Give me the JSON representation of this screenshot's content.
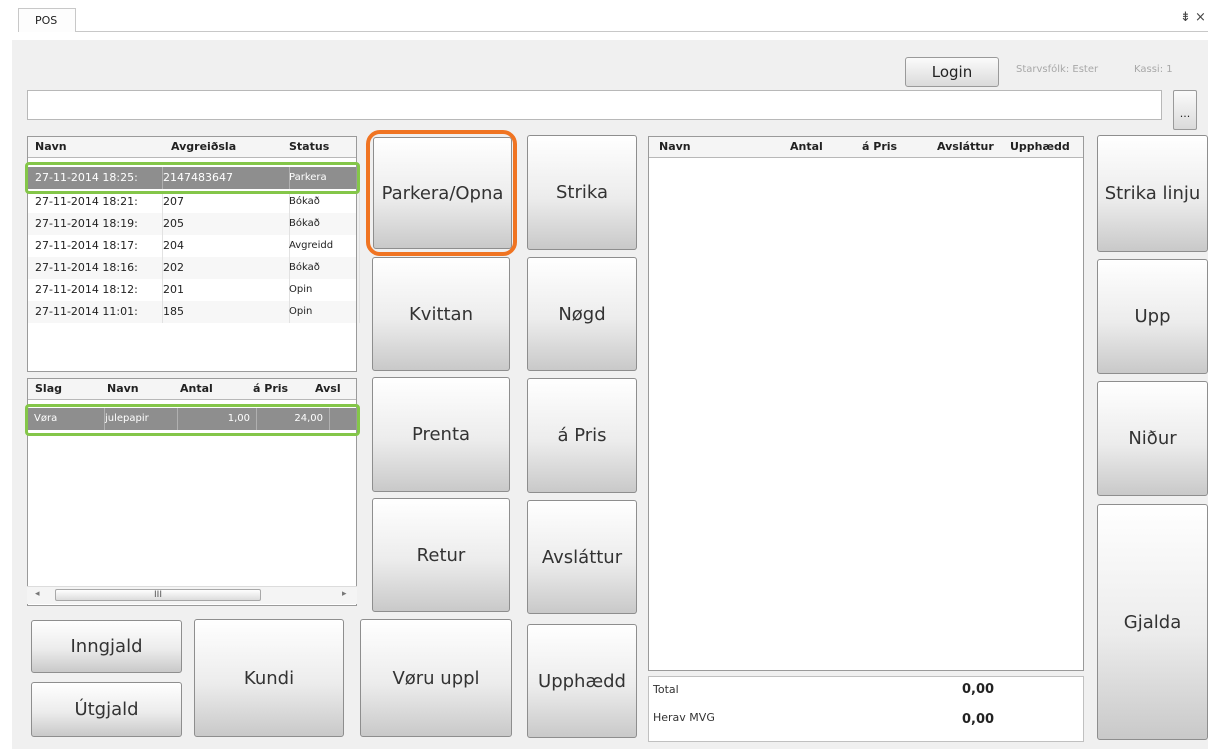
{
  "window": {
    "tab_title": "POS",
    "pin": "⇟ ×"
  },
  "header": {
    "login_label": "Login",
    "staff_label": "Starvsfólk: Ester",
    "register_label": "Kassi: 1",
    "search_value": "",
    "more_label": "..."
  },
  "orders": {
    "columns": [
      "Navn",
      "Avgreiðsla",
      "Status"
    ],
    "rows": [
      [
        "27-11-2014 18:25:",
        "2147483647",
        "Parkera"
      ],
      [
        "27-11-2014 18:21:",
        "207",
        "Bókað"
      ],
      [
        "27-11-2014 18:19:",
        "205",
        "Bókað"
      ],
      [
        "27-11-2014 18:17:",
        "204",
        "Avgreidd"
      ],
      [
        "27-11-2014 18:16:",
        "202",
        "Bókað"
      ],
      [
        "27-11-2014 18:12:",
        "201",
        "Opin"
      ],
      [
        "27-11-2014 11:01:",
        "185",
        "Opin"
      ]
    ]
  },
  "items": {
    "columns": [
      "Slag",
      "Navn",
      "Antal",
      "á Pris",
      "Avsl"
    ],
    "rows": [
      [
        "Vøra",
        "julepapir",
        "1,00",
        "24,00",
        ""
      ]
    ],
    "scroll_thumb": "III"
  },
  "buttons": {
    "parkera": "Parkera/Opna",
    "kvittan": "Kvittan",
    "prenta": "Prenta",
    "retur": "Retur",
    "strika": "Strika",
    "nogd": "Nøgd",
    "a_pris": "á Pris",
    "avslattur": "Avsláttur",
    "upphaedd": "Upphædd",
    "inngjald": "Inngjald",
    "utgjald": "Útgjald",
    "kundi": "Kundi",
    "voru_uppl": "Vøru uppl",
    "strika_linju": "Strika linju",
    "upp": "Upp",
    "nidur": "Niður",
    "gjalda": "Gjalda"
  },
  "cart": {
    "columns": [
      "Navn",
      "Antal",
      "á Pris",
      "Avsláttur",
      "Upphædd"
    ],
    "rows": []
  },
  "totals": {
    "total_label": "Total",
    "total_value": "0,00",
    "vat_label": "Herav MVG",
    "vat_value": "0,00"
  },
  "colors": {
    "highlight_green": "#84c649",
    "highlight_orange": "#f07422",
    "selected_row": "#8e8e8e"
  }
}
